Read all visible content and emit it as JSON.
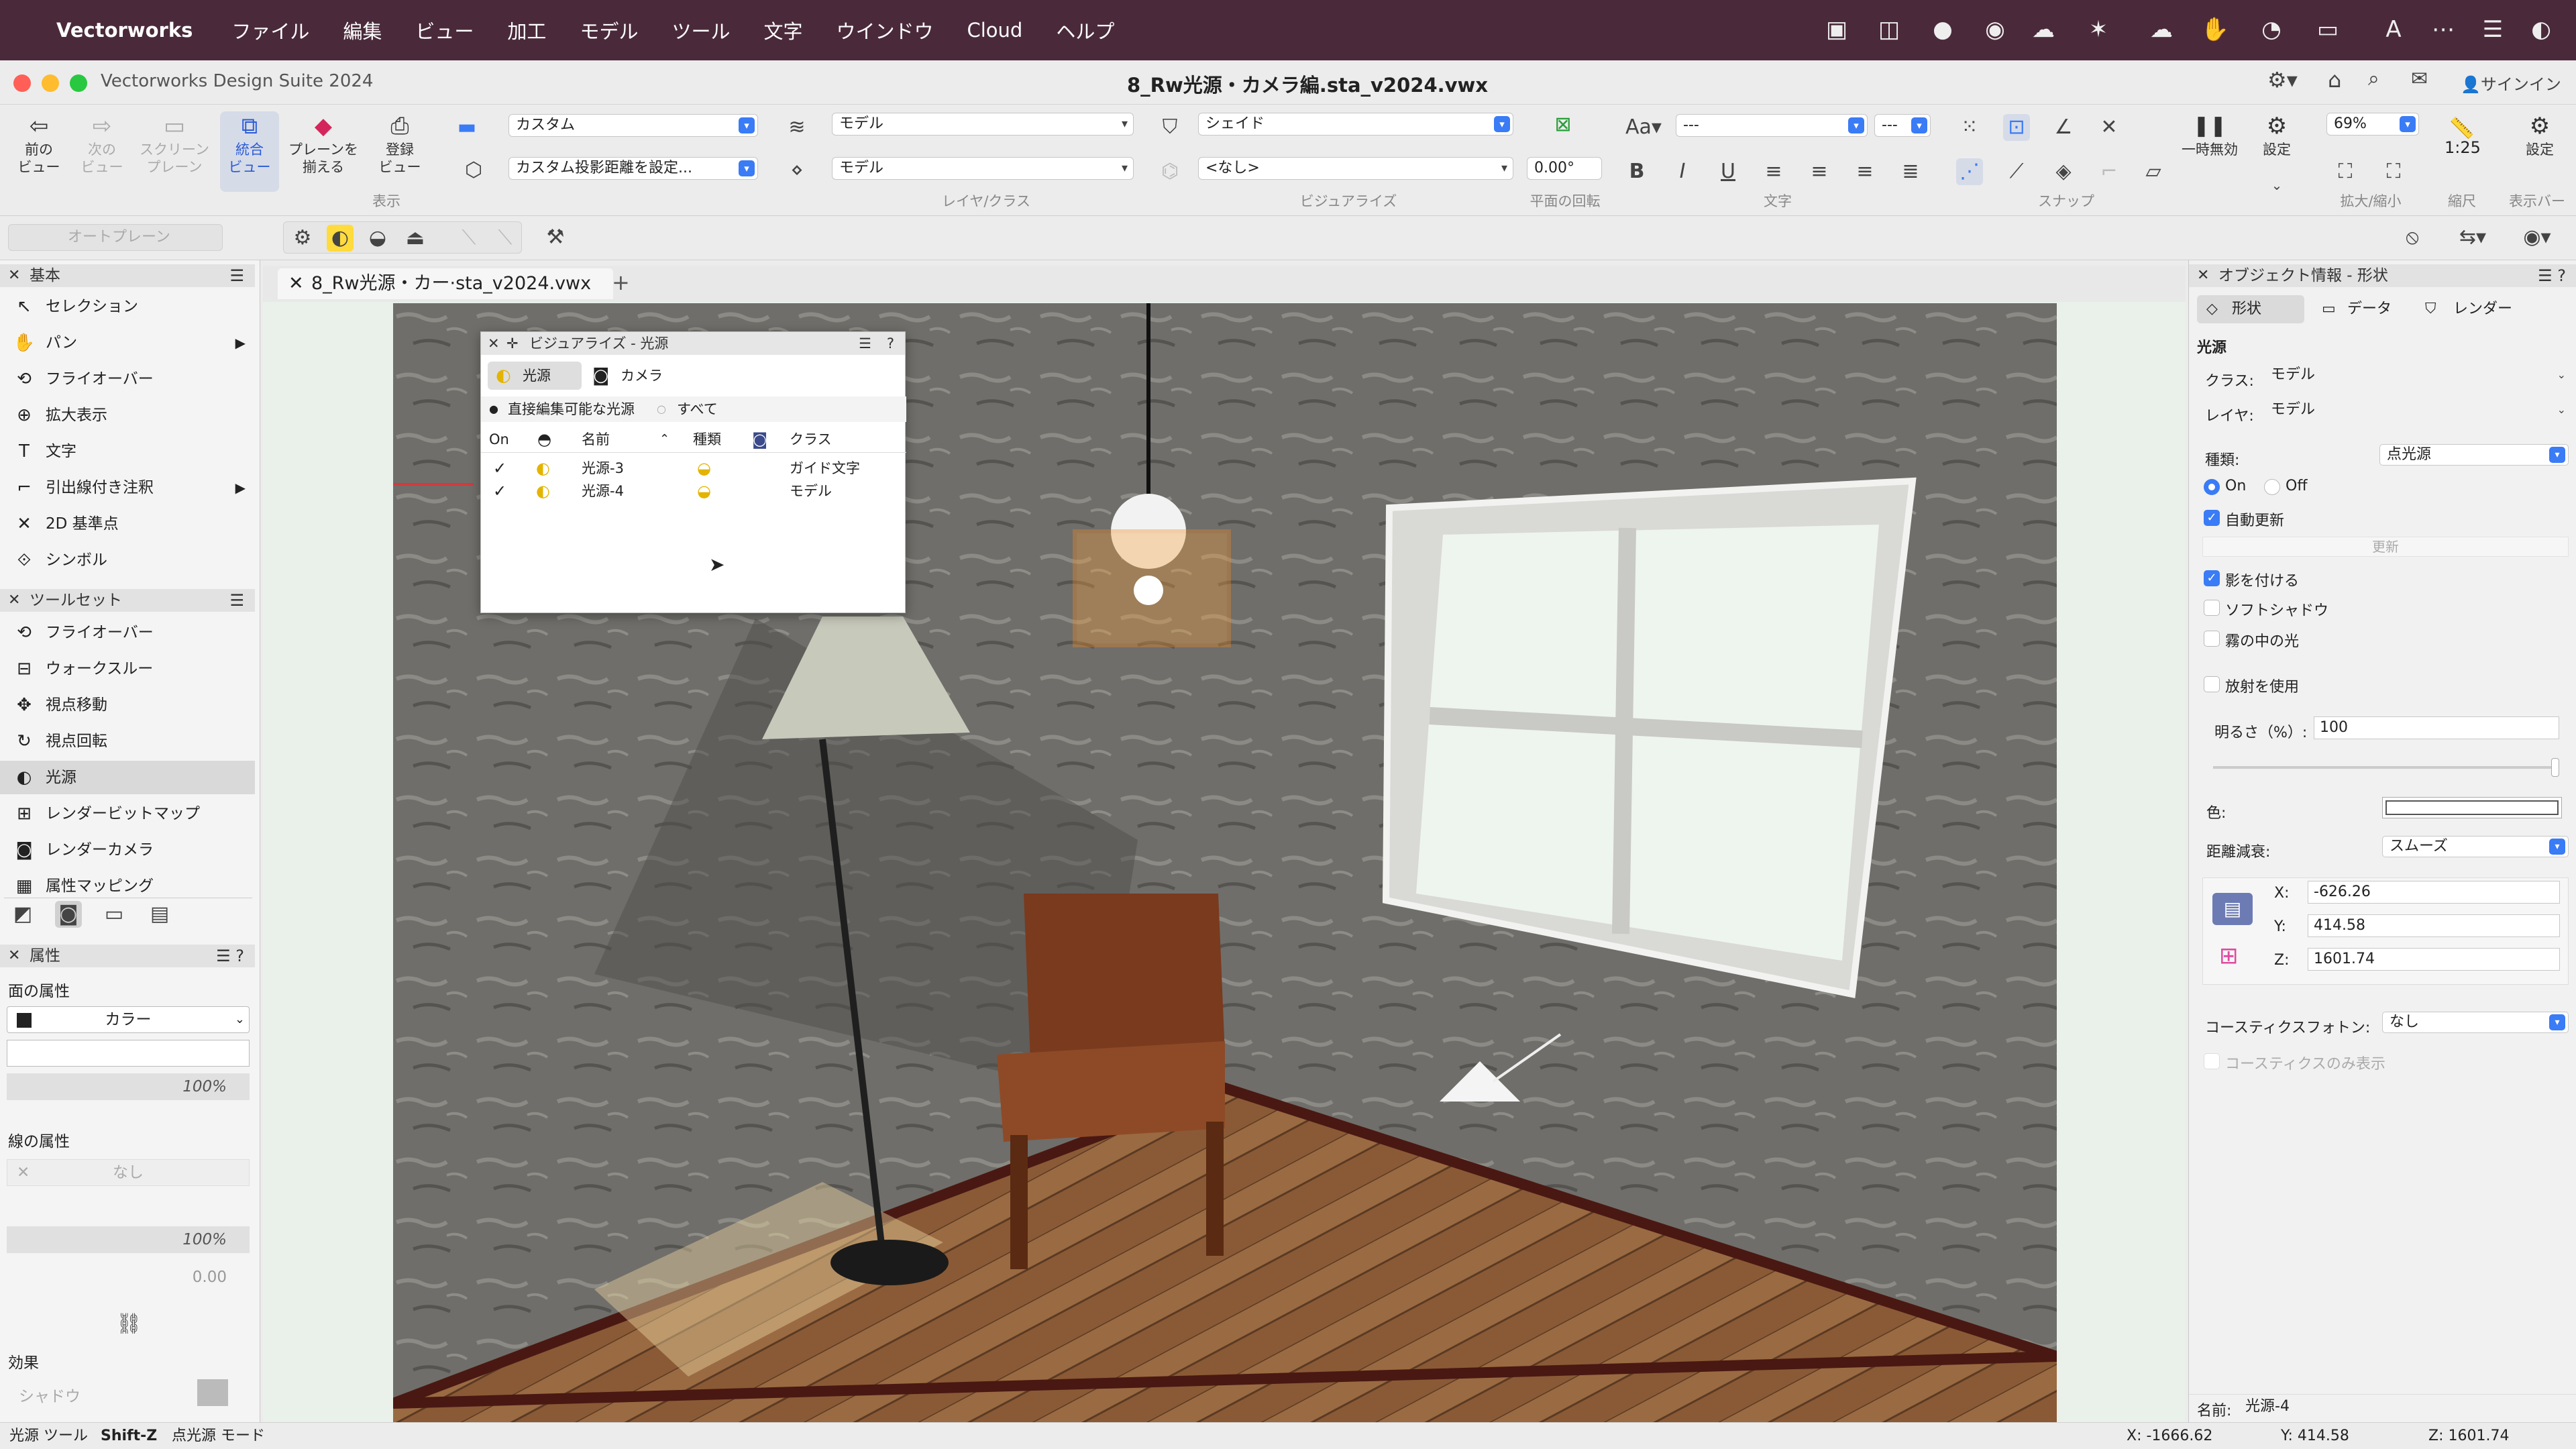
{
  "menubar": {
    "app": "Vectorworks",
    "items": [
      "ファイル",
      "編集",
      "ビュー",
      "加工",
      "モデル",
      "ツール",
      "文字",
      "ウインドウ",
      "Cloud",
      "ヘルプ"
    ]
  },
  "window": {
    "app_title": "Vectorworks Design Suite 2024",
    "doc_title": "8_Rw光源・カメラ編.sta_v2024.vwx",
    "signin": "サインイン"
  },
  "toolbar": {
    "prev_view": "前の\nビュー",
    "next_view": "次の\nビュー",
    "screen_plane": "スクリーン\nプレーン",
    "unified_view": "統合\nビュー",
    "align_plane": "プレーンを\n揃える",
    "saved_view": "登録\nビュー",
    "group_display": "表示",
    "custom": "カスタム",
    "custom_projection": "カスタム投影距離を設定...",
    "layer_top": "モデル",
    "layer_bottom": "モデル",
    "group_layer": "レイヤ/クラス",
    "render_mode": "シェイド",
    "light_none": "<なし>",
    "group_visualize": "ビジュアライズ",
    "rotation": "0.00°",
    "group_rotation": "平面の回転",
    "font_placeholder": "---",
    "size_placeholder": "---",
    "group_text": "文字",
    "group_snap": "スナップ",
    "pause_label": "一時無効",
    "settings_label": "設定",
    "zoom": "69%",
    "scale": "1:25",
    "group_zoom": "拡大/縮小",
    "group_scale": "縮尺",
    "settings2": "設定",
    "group_display_bar": "表示バー"
  },
  "toolbar2": {
    "auto_plane": "オートプレーン"
  },
  "left": {
    "basic_title": "基本",
    "basic_tools": [
      {
        "label": "セレクション",
        "icon": "arrow-icon"
      },
      {
        "label": "パン",
        "icon": "hand-icon",
        "sub": true
      },
      {
        "label": "フライオーバー",
        "icon": "flyover-icon"
      },
      {
        "label": "拡大表示",
        "icon": "zoom-icon"
      },
      {
        "label": "文字",
        "icon": "text-icon"
      },
      {
        "label": "引出線付き注釈",
        "icon": "callout-icon",
        "sub": true
      },
      {
        "label": "2D 基準点",
        "icon": "locus-icon"
      },
      {
        "label": "シンボル",
        "icon": "symbol-icon"
      }
    ],
    "toolset_title": "ツールセット",
    "toolset_tools": [
      {
        "label": "フライオーバー",
        "icon": "flyover-icon"
      },
      {
        "label": "ウォークスルー",
        "icon": "walkthrough-icon"
      },
      {
        "label": "視点移動",
        "icon": "translate-view-icon"
      },
      {
        "label": "視点回転",
        "icon": "rotate-view-icon"
      },
      {
        "label": "光源",
        "icon": "light-icon",
        "selected": true
      },
      {
        "label": "レンダービットマップ",
        "icon": "render-bitmap-icon"
      },
      {
        "label": "レンダーカメラ",
        "icon": "render-camera-icon"
      },
      {
        "label": "属性マッピング",
        "icon": "attribute-mapping-icon"
      }
    ],
    "attr_title": "属性",
    "fill_label": "面の属性",
    "fill_type": "カラー",
    "fill_opacity": "100%",
    "line_label": "線の属性",
    "line_type": "なし",
    "line_opacity": "100%",
    "line_thickness": "0.00",
    "effects_label": "効果",
    "shadow_label": "シャドウ"
  },
  "document_tab": {
    "label": "8_Rw光源・カー·sta_v2024.vwx"
  },
  "vis_palette": {
    "title": "ビジュアライズ - 光源",
    "tab_lights": "光源",
    "tab_cameras": "カメラ",
    "radio_editable": "直接編集可能な光源",
    "radio_all": "すべて",
    "col_on": "On",
    "col_name": "名前",
    "col_type": "種類",
    "col_class": "クラス",
    "rows": [
      {
        "on": true,
        "name": "光源-3",
        "class": "ガイド文字"
      },
      {
        "on": true,
        "name": "光源-4",
        "class": "モデル"
      }
    ]
  },
  "right": {
    "title": "オブジェクト情報 - 形状",
    "tab_shape": "形状",
    "tab_data": "データ",
    "tab_render": "レンダー",
    "section": "光源",
    "class_label": "クラス:",
    "class_value": "モデル",
    "layer_label": "レイヤ:",
    "layer_value": "モデル",
    "kind_label": "種類:",
    "kind_value": "点光源",
    "on_label": "On",
    "off_label": "Off",
    "auto_update": "自動更新",
    "update_btn": "更新",
    "cast_shadow": "影を付ける",
    "soft_shadow": "ソフトシャドウ",
    "fog_light": "霧の中の光",
    "use_emitter": "放射を使用",
    "brightness_label": "明るさ（%）:",
    "brightness_value": "100",
    "color_label": "色:",
    "falloff_label": "距離減衰:",
    "falloff_value": "スムーズ",
    "x_label": "X:",
    "x_value": "-626.26",
    "y_label": "Y:",
    "y_value": "414.58",
    "z_label": "Z:",
    "z_value": "1601.74",
    "caustic_label": "コースティクスフォトン:",
    "caustic_value": "なし",
    "caustic_only": "コースティクスのみ表示",
    "name_label": "名前:",
    "name_value": "光源-4"
  },
  "status": {
    "tool": "光源 ツール",
    "shortcut": "Shift-Z",
    "mode": "点光源 モード",
    "x": "X: -1666.62",
    "y": "Y: 414.58",
    "z": "Z: 1601.74"
  },
  "colors": {
    "menubar": "#4a2a3a",
    "accent": "#3a7bf6",
    "wall": "#6e6d69",
    "floor": "#8a5a36",
    "selection": "#f08a1e"
  }
}
